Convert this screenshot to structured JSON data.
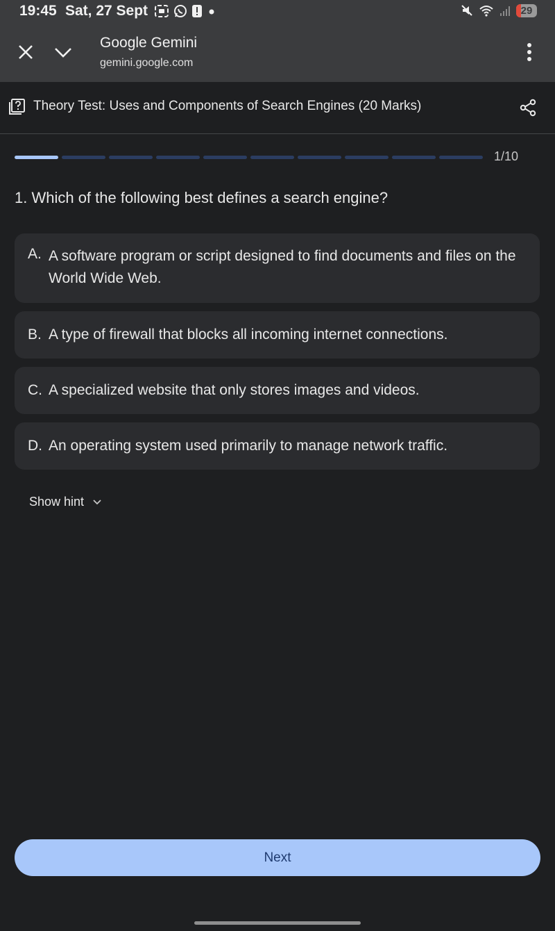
{
  "status_bar": {
    "time": "19:45",
    "date": "Sat, 27 Sept",
    "battery": "29",
    "icons": [
      "screenshot-icon",
      "whatsapp-icon",
      "alert-icon",
      "dot-icon",
      "mute-icon",
      "wifi-icon",
      "signal-icon",
      "battery-icon"
    ]
  },
  "browser": {
    "title": "Google Gemini",
    "url": "gemini.google.com"
  },
  "quiz": {
    "title": "Theory Test: Uses and Components of Search Engines (20 Marks)",
    "progress_current": 1,
    "progress_total": 10,
    "counter": "1/10",
    "question": "1. Which of the following best defines a search engine?",
    "options": [
      {
        "letter": "A.",
        "text": "A software program or script designed to find documents and files on the World Wide Web."
      },
      {
        "letter": "B.",
        "text": "A type of firewall that blocks all incoming internet connections."
      },
      {
        "letter": "C.",
        "text": "A specialized website that only stores images and videos."
      },
      {
        "letter": "D.",
        "text": "An operating system used primarily to manage network traffic."
      }
    ],
    "hint_label": "Show hint",
    "next_label": "Next"
  },
  "colors": {
    "background": "#1e1f21",
    "topbar": "#3b3c3e",
    "option_bg": "#2b2c2f",
    "accent": "#a8c7fa",
    "progress_inactive": "#2b3d61",
    "next_text": "#1f3b70"
  }
}
